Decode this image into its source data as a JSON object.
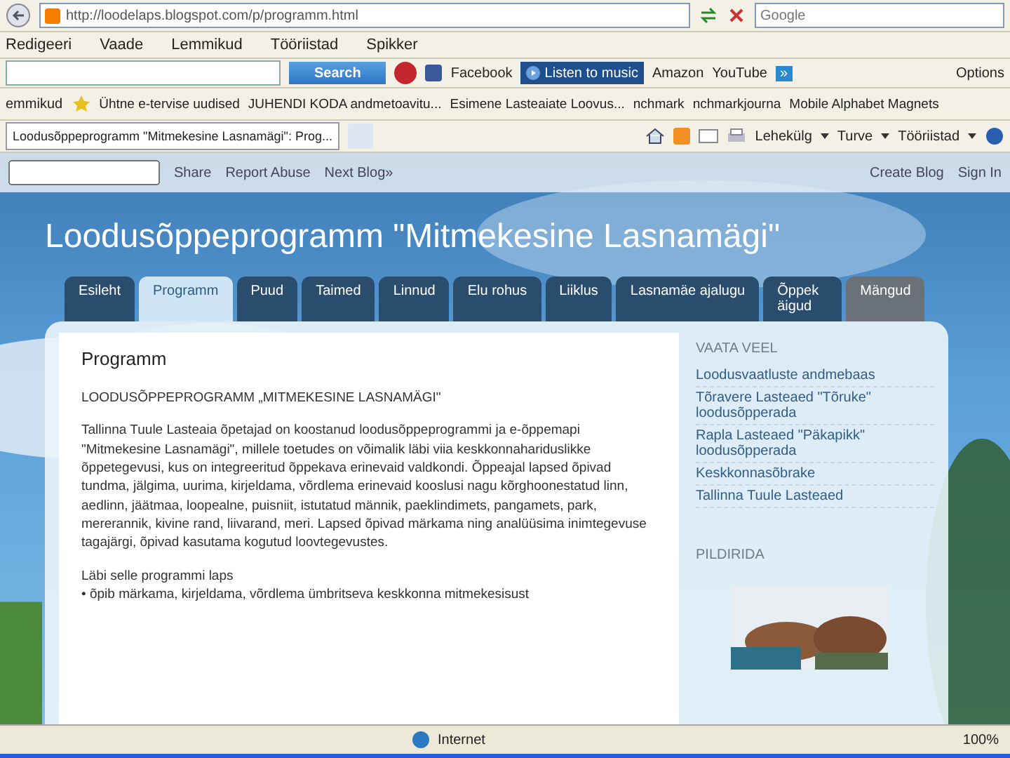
{
  "address_bar": {
    "url": "http://loodelaps.blogspot.com/p/programm.html",
    "search_placeholder": "Google"
  },
  "menu": [
    "Redigeeri",
    "Vaade",
    "Lemmikud",
    "Tööriistad",
    "Spikker"
  ],
  "toolbar": {
    "search_button": "Search",
    "facebook": "Facebook",
    "music": "Listen to music",
    "links": [
      "Amazon",
      "YouTube"
    ],
    "more": "»",
    "options": "Options"
  },
  "favorites": {
    "label": "emmikud",
    "items": [
      "Ühtne e-tervise uudised",
      "JUHENDI KODA andmetoavitu...",
      "Esimene Lasteaiate Loovus...",
      "nchmark",
      "nchmarkjourna",
      "Mobile Alphabet Magnets"
    ]
  },
  "browser_tabs": [
    {
      "title": "Loodusõppeprogramm \"Mitmekesine Lasnamägi\": Prog...",
      "selected": true
    }
  ],
  "command_bar": [
    "Lehekülg",
    "Turve",
    "Tööriistad"
  ],
  "navbar": {
    "links": [
      "Share",
      "Report Abuse",
      "Next Blog»"
    ],
    "right_links": [
      "Create Blog",
      "Sign In"
    ]
  },
  "blog": {
    "title": "Loodusõppeprogramm \"Mitmekesine Lasnamägi\"",
    "tabs": [
      {
        "label": "Esileht",
        "selected": false
      },
      {
        "label": "Programm",
        "selected": true
      },
      {
        "label": "Puud",
        "selected": false
      },
      {
        "label": "Taimed",
        "selected": false
      },
      {
        "label": "Linnud",
        "selected": false
      },
      {
        "label": "Elu rohus",
        "selected": false
      },
      {
        "label": "Liiklus",
        "selected": false
      },
      {
        "label": "Lasnamäe ajalugu",
        "selected": false
      },
      {
        "label": "Õppek äigud",
        "selected": false
      },
      {
        "label": "Mängud",
        "selected": false
      }
    ]
  },
  "post": {
    "title": "Programm",
    "heading": "LOODUSÕPPEPROGRAMM „MITMEKESINE LASNAMÄGI\"",
    "paragraph": "Tallinna Tuule Lasteaia õpetajad on koostanud loodusõppeprogrammi ja e-õppemapi \"Mitmekesine Lasnamägi\", millele toetudes on võimalik läbi viia keskkonnahariduslikke õppetegevusi, kus on integreeritud õppekava erinevaid valdkondi. Õppeajal lapsed õpivad tundma, jälgima, uurima, kirjeldama, võrdlema erinevaid kooslusi nagu kõrghoonestatud linn, aedlinn, jäätmaa, loopealne, puisniit, istutatud männik, paeklindimets, pangamets, park, mererannik, kivine rand, liivarand, meri. Lapsed õpivad märkama ning analüüsima inimtegevuse tagajärgi, õpivad kasutama kogutud loovtegevustes.",
    "intro": "Läbi selle programmi laps",
    "bullet": "• õpib märkama, kirjeldama, võrdlema ümbritseva keskkonna mitmekesisust"
  },
  "sidebar": {
    "heading": "VAATA VEEL",
    "links": [
      "Loodusvaatluste andmebaas",
      "Tõravere Lasteaed \"Tõruke\" loodusõpperada",
      "Rapla Lasteaed \"Päkapikk\" loodusõpperada",
      "Keskkonnasõbrake",
      "Tallinna Tuule Lasteaed"
    ],
    "heading2": "PILDIRIDA"
  },
  "status_bar": {
    "zone": "Internet",
    "zoom": "100%"
  }
}
